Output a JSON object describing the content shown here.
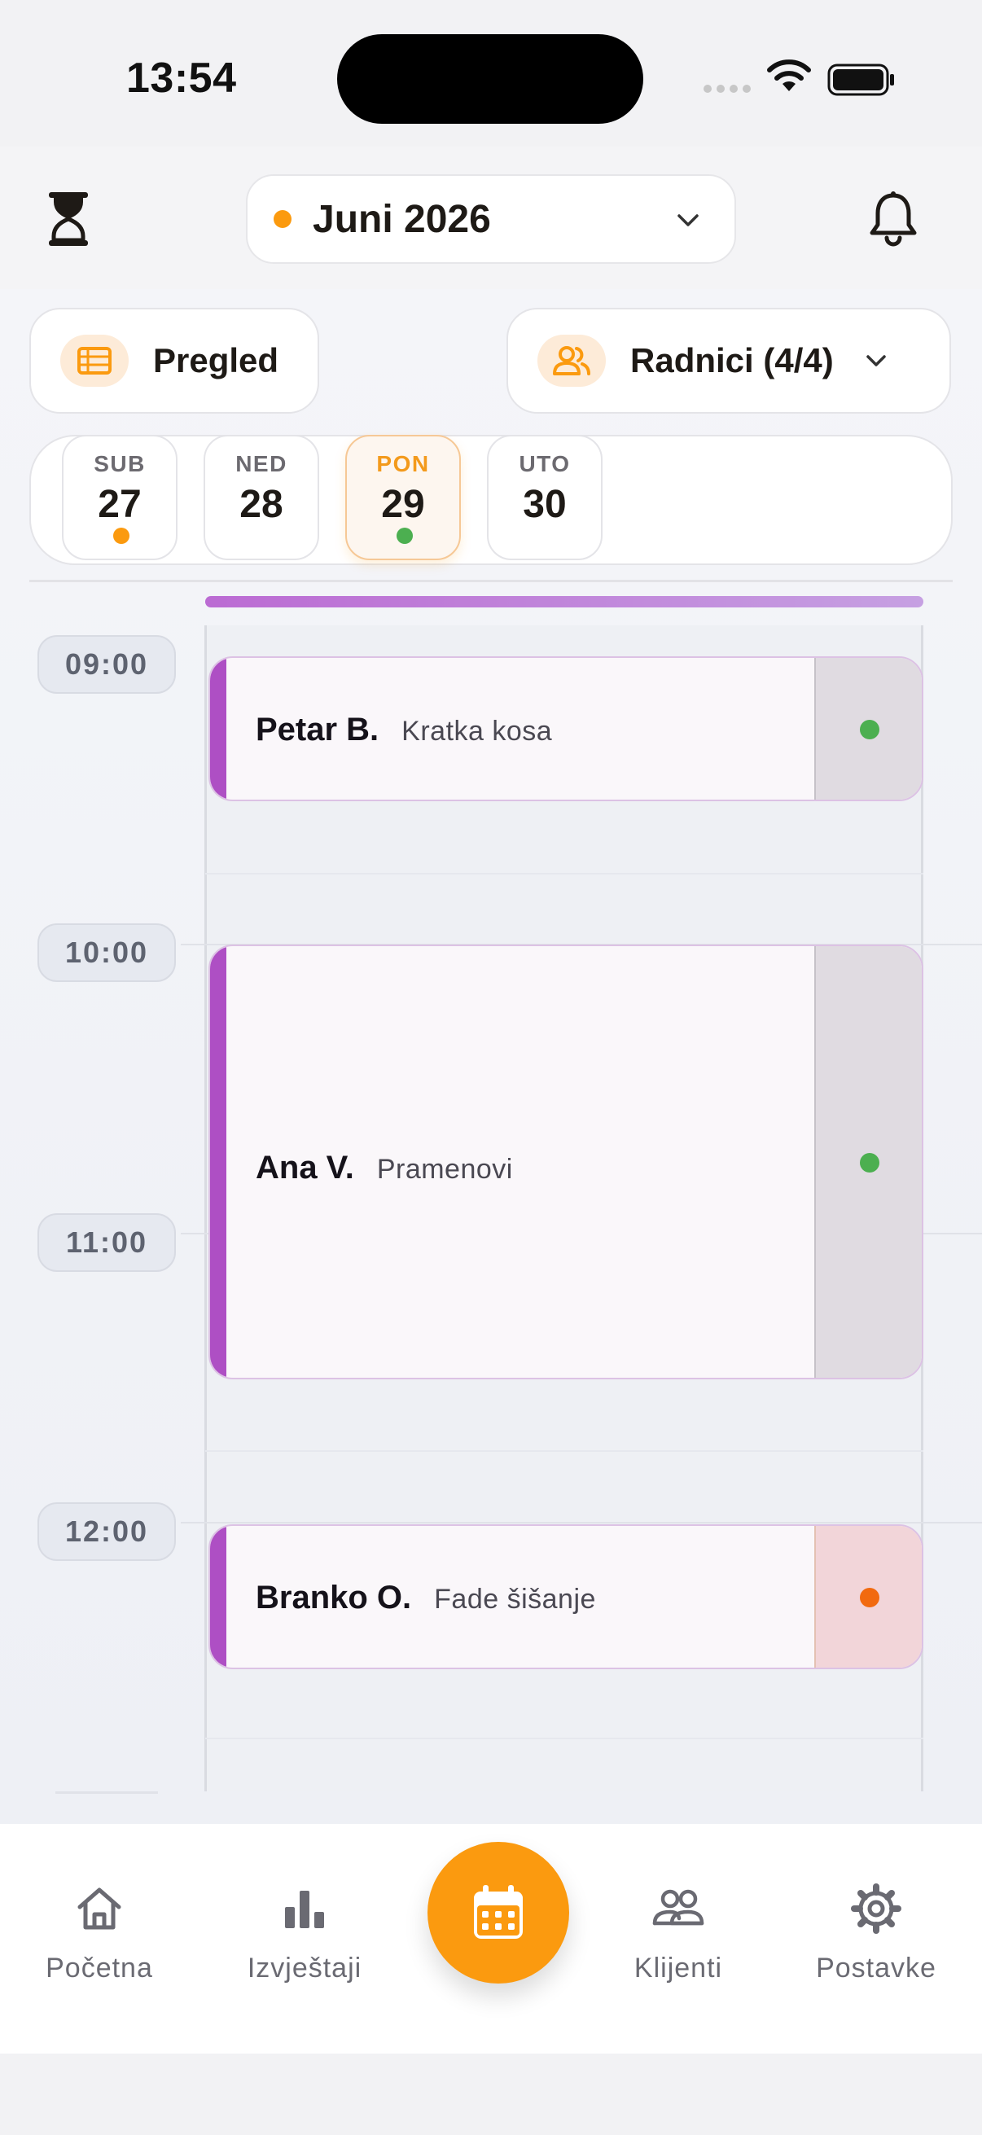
{
  "status_bar": {
    "time": "13:54"
  },
  "header": {
    "month_label": "Juni 2026",
    "month_dot_color": "#fb9a0f"
  },
  "toolbar": {
    "overview_label": "Pregled",
    "workers_label": "Radnici (4/4)"
  },
  "days": [
    {
      "dow": "SUB",
      "num": "27",
      "dot": "#fb9a0f",
      "selected": false
    },
    {
      "dow": "NED",
      "num": "28",
      "dot": null,
      "selected": false
    },
    {
      "dow": "PON",
      "num": "29",
      "dot": "#4caf50",
      "selected": true
    },
    {
      "dow": "UTO",
      "num": "30",
      "dot": null,
      "selected": false
    }
  ],
  "timeline": {
    "hours": [
      "09:00",
      "10:00",
      "11:00",
      "12:00"
    ],
    "appointments": [
      {
        "client": "Petar B.",
        "service": "Kratka kosa",
        "status_color": "#4caf50"
      },
      {
        "client": "Ana V.",
        "service": "Pramenovi",
        "status_color": "#4caf50"
      },
      {
        "client": "Branko O.",
        "service": "Fade šišanje",
        "status_color": "#f26a0f"
      }
    ]
  },
  "nav": {
    "home": "Početna",
    "reports": "Izvještaji",
    "clients": "Klijenti",
    "settings": "Postavke"
  },
  "colors": {
    "accent": "#fb9a0f",
    "appointment_stripe": "#ae4fc4",
    "background": "#f2f2f4"
  }
}
